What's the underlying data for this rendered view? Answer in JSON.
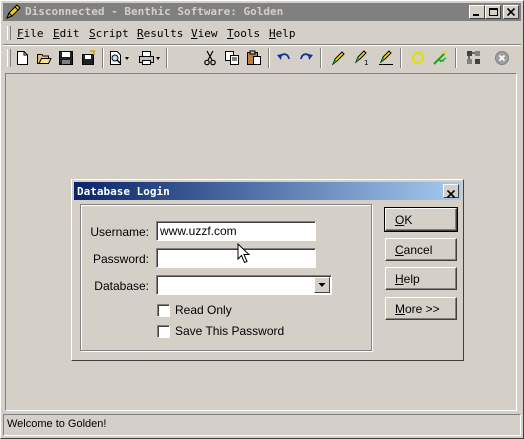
{
  "window": {
    "title": "Disconnected - Benthic Software: Golden"
  },
  "menubar": {
    "items": [
      "File",
      "Edit",
      "Script",
      "Results",
      "View",
      "Tools",
      "Help"
    ]
  },
  "toolbar": {
    "buttons": [
      "new-icon",
      "open-icon",
      "save-icon",
      "save-as-icon",
      "print-preview-icon",
      "print-icon",
      "cut-icon",
      "copy-icon",
      "paste-icon",
      "undo-icon",
      "redo-icon",
      "execute-icon",
      "execute-step-icon",
      "explain-icon",
      "commit-icon",
      "rollback-icon",
      "schema-icon",
      "cancel-icon"
    ]
  },
  "status": {
    "text": "Welcome to Golden!"
  },
  "dialog": {
    "title": "Database Login",
    "username_label": "Username:",
    "username_value": "www.uzzf.com",
    "password_label": "Password:",
    "password_value": "",
    "database_label": "Database:",
    "database_value": "",
    "read_only_label": "Read Only",
    "read_only_checked": false,
    "save_password_label": "Save This Password",
    "save_password_checked": false,
    "ok_label": "OK",
    "cancel_label": "Cancel",
    "help_label": "Help",
    "more_label": "More >>"
  },
  "colors": {
    "dialog_title_start": "#0a246a",
    "dialog_title_end": "#a6caf0",
    "inactive_title": "#808080",
    "face": "#d4d0c8"
  }
}
